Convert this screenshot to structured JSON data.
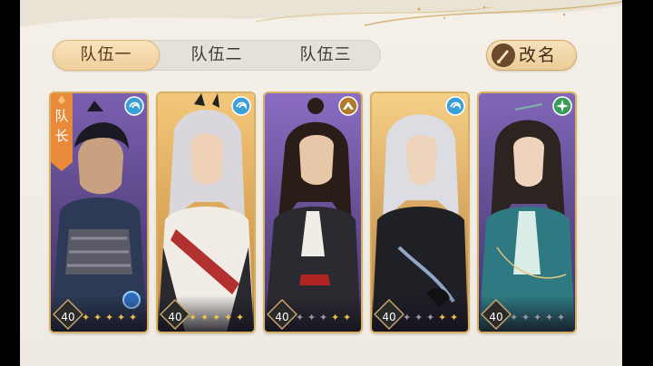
{
  "tabs": [
    {
      "label": "队伍一",
      "active": true
    },
    {
      "label": "队伍二",
      "active": false
    },
    {
      "label": "队伍三",
      "active": false
    }
  ],
  "rename_button": {
    "label": "改名",
    "icon": "brush-icon"
  },
  "cards": [
    {
      "level": "40",
      "stars_filled": 5,
      "stars_total": 5,
      "element": "water-swirl",
      "element_color": "#3aa0d8",
      "frame": "purple",
      "leader": true,
      "leader_label": "队长"
    },
    {
      "level": "40",
      "stars_filled": 5,
      "stars_total": 5,
      "element": "water-swirl",
      "element_color": "#3aa0d8",
      "frame": "gold",
      "leader": false
    },
    {
      "level": "40",
      "stars_filled": 2,
      "stars_total": 5,
      "element": "mountain",
      "element_color": "#b07a2a",
      "frame": "purple",
      "leader": false
    },
    {
      "level": "40",
      "stars_filled": 2,
      "stars_total": 5,
      "element": "water-swirl",
      "element_color": "#3aa0d8",
      "frame": "gold",
      "leader": false
    },
    {
      "level": "40",
      "stars_filled": 0,
      "stars_total": 5,
      "element": "wind-leaf",
      "element_color": "#3c9a5a",
      "frame": "purple",
      "leader": false
    }
  ],
  "colors": {
    "accent_gold": "#e0b56e",
    "panel_bg": "#f2eee6"
  }
}
